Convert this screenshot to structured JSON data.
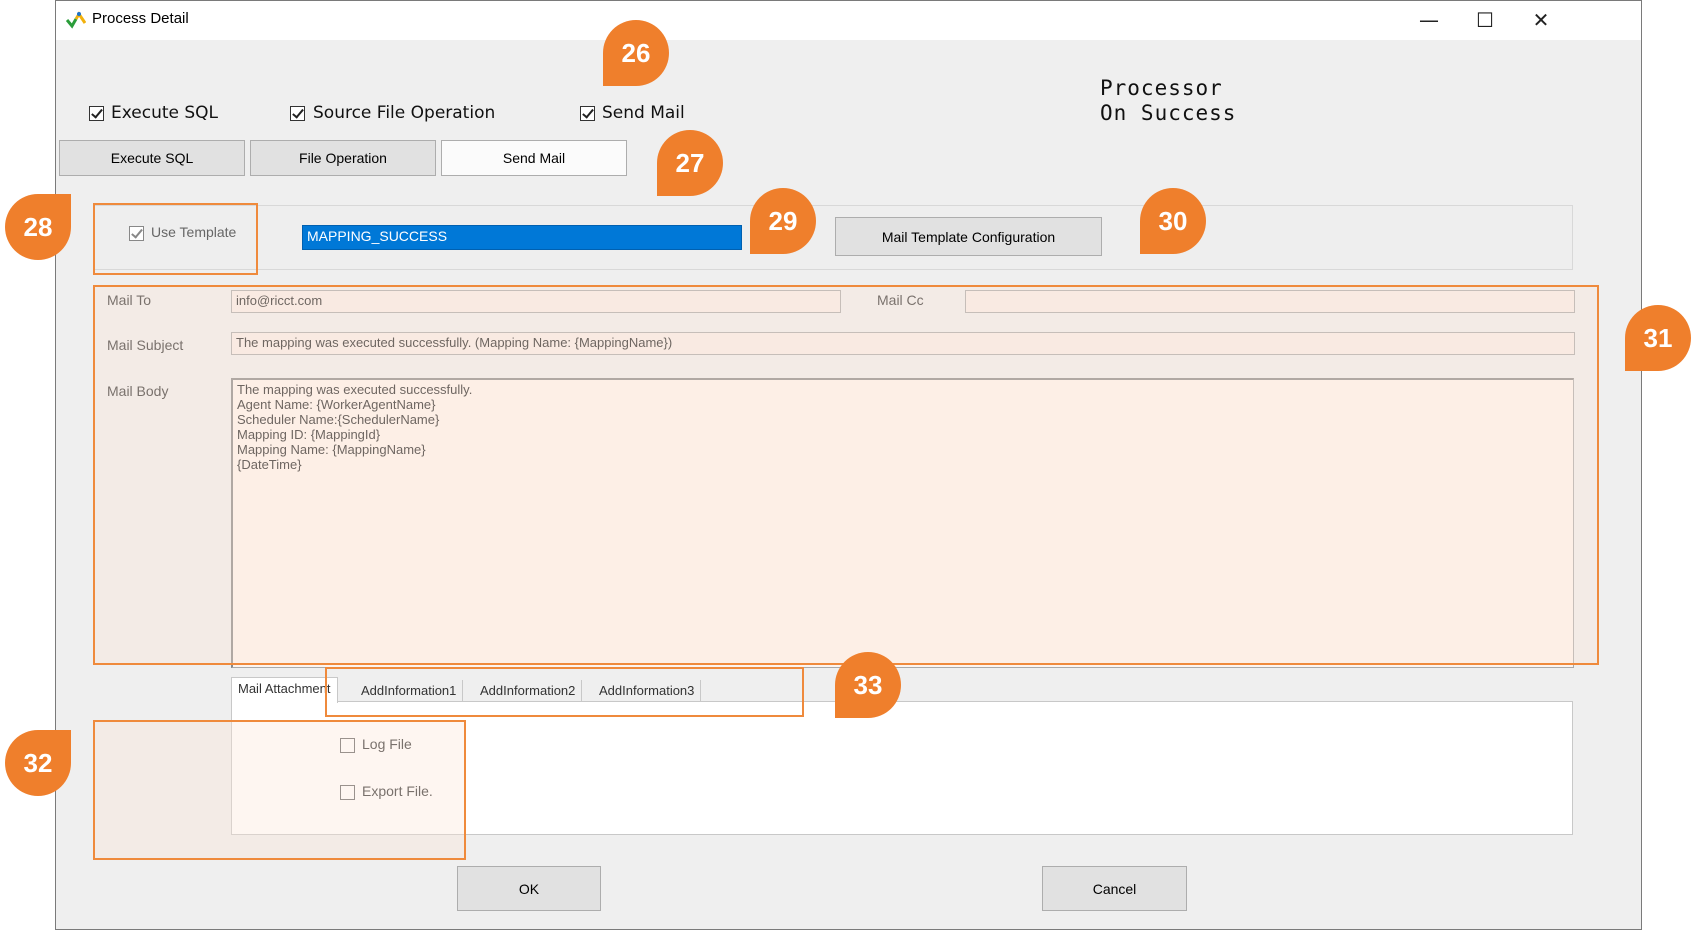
{
  "window": {
    "title": "Process Detail",
    "controls": {
      "minimize": "—",
      "maximize": "☐",
      "close": "✕"
    }
  },
  "options": {
    "execute_sql": {
      "label": "Execute SQL",
      "checked": true
    },
    "source_file_operation": {
      "label": "Source File Operation",
      "checked": true
    },
    "send_mail": {
      "label": "Send Mail",
      "checked": true
    }
  },
  "processor_label": {
    "line1": "Processor",
    "line2": "On Success"
  },
  "tabs": {
    "execute_sql": "Execute SQL",
    "file_operation": "File Operation",
    "send_mail": "Send Mail"
  },
  "template": {
    "use_template_label": "Use Template",
    "use_template_checked": true,
    "selected": "MAPPING_SUCCESS",
    "config_button": "Mail Template Configuration"
  },
  "mail": {
    "to_label": "Mail To",
    "to_value": "info@ricct.com",
    "cc_label": "Mail Cc",
    "cc_value": "",
    "subject_label": "Mail Subject",
    "subject_value": "The mapping was executed successfully. (Mapping Name: {MappingName})",
    "body_label": "Mail Body",
    "body_lines": [
      "The mapping was executed successfully.",
      "",
      "",
      "Agent Name: {WorkerAgentName}",
      "Scheduler Name:{SchedulerName}",
      "Mapping ID: {MappingId}",
      "Mapping Name: {MappingName}",
      "",
      "{DateTime}"
    ]
  },
  "attachment_tabs": [
    "Mail Attachment",
    "AddInformation1",
    "AddInformation2",
    "AddInformation3"
  ],
  "attachments": {
    "log_file": {
      "label": "Log File",
      "checked": false
    },
    "export_file": {
      "label": "Export File.",
      "checked": false
    }
  },
  "buttons": {
    "ok": "OK",
    "cancel": "Cancel"
  },
  "callouts": [
    "26",
    "27",
    "28",
    "29",
    "30",
    "31",
    "32",
    "33"
  ],
  "colors": {
    "callout": "#ef7f2c",
    "highlight": "#0078d7"
  }
}
